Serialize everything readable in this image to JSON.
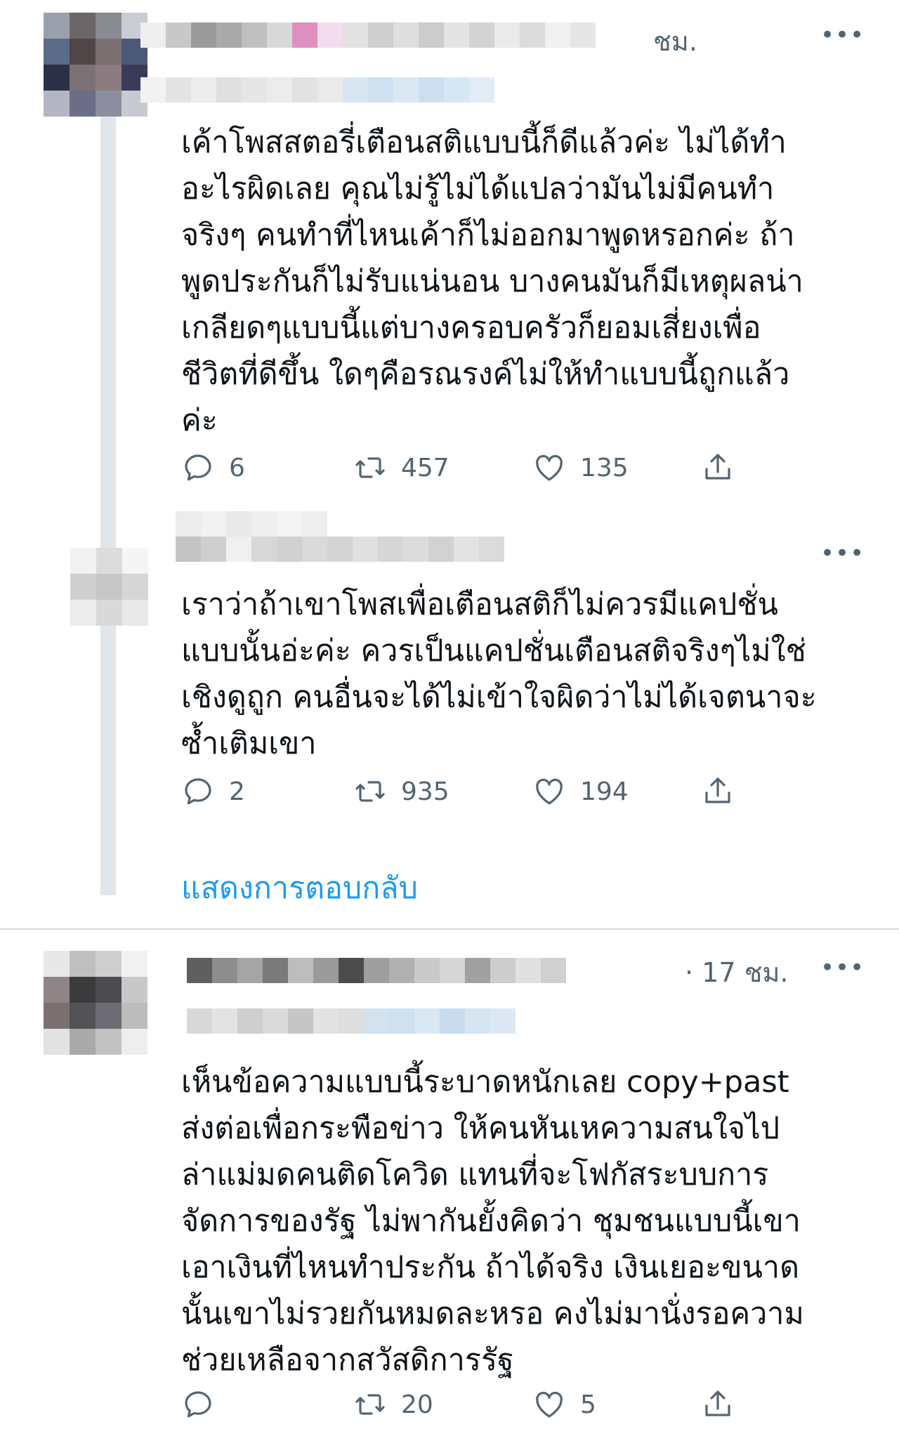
{
  "tweets": [
    {
      "time": "ชม.",
      "text": "เค้าโพสสตอรี่เตือนสติแบบนี้ก็ดีแล้วค่ะ ไม่ได้ทำ\nอะไรผิดเลย คุณไม่รู้ไม่ได้แปลว่ามันไม่มีคนทำ\nจริงๆ คนทำที่ไหนเค้าก็ไม่ออกมาพูดหรอกค่ะ ถ้า\nพูดประกันก็ไม่รับแน่นอน บางคนมันก็มีเหตุผลน่า\nเกลียดๆแบบนี้แต่บางครอบครัวก็ยอมเสี่ยงเพื่อ\nชีวิตที่ดีขึ้น ใดๆคือรณรงค์ไม่ให้ทำแบบนี้ถูกแล้ว\nค่ะ",
      "replies": "6",
      "retweets": "457",
      "likes": "135"
    },
    {
      "time": "",
      "text": "เราว่าถ้าเขาโพสเพื่อเตือนสติก็ไม่ควรมีแคปชั่น\nแบบนั้นอ่ะค่ะ ควรเป็นแคปชั่นเตือนสติจริงๆไม่ใช่\nเชิงดูถูก คนอื่นจะได้ไม่เข้าใจผิดว่าไม่ได้เจตนาจะ\nซ้ำเติมเขา",
      "replies": "2",
      "retweets": "935",
      "likes": "194"
    },
    {
      "time": "· 17 ชม.",
      "text": "เห็นข้อความแบบนี้ระบาดหนักเลย copy+past\nส่งต่อเพื่อกระพือข่าว ให้คนหันเหความสนใจไป\nล่าแม่มดคนติดโควิด แทนที่จะโฟกัสระบบการ\nจัดการของรัฐ ไม่พากันยั้งคิดว่า ชุมชนแบบนี้เขา\nเอาเงินที่ไหนทำประกัน ถ้าได้จริง เงินเยอะขนาด\nนั้นเขาไม่รวยกันหมดละหรอ คงไม่มานั่งรอความ\nช่วยเหลือจากสวัสดิการรัฐ",
      "replies": "",
      "retweets": "20",
      "likes": "5"
    }
  ],
  "show_replies_label": "แสดงการตอบกลับ",
  "more_label": "•••",
  "colors": {
    "link": "#1d9bf0",
    "secondary_text": "#536471",
    "thread_line": "#e1e6ea"
  },
  "icons": [
    "reply-icon",
    "retweet-icon",
    "like-icon",
    "share-icon",
    "more-icon"
  ]
}
